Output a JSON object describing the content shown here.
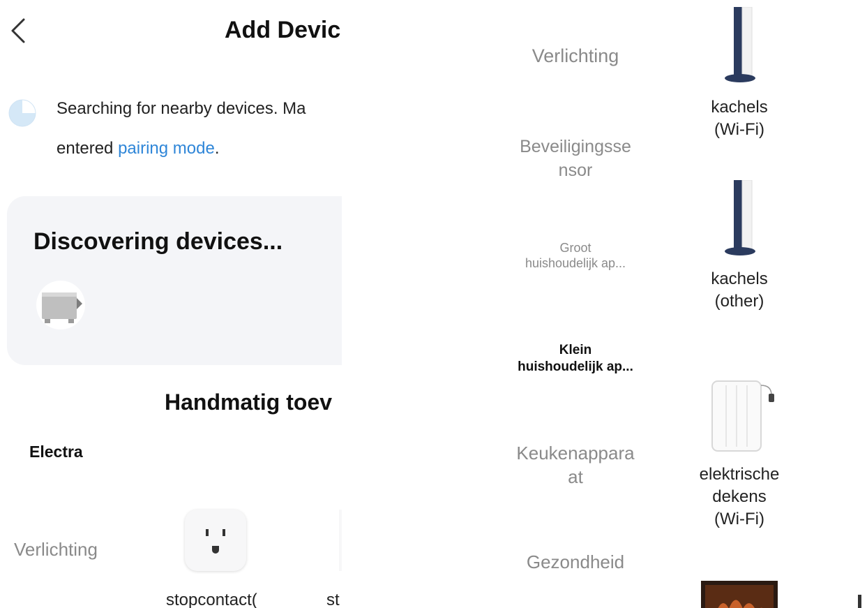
{
  "header": {
    "title": "Add Devic"
  },
  "search": {
    "line1": "Searching for nearby devices. Ma",
    "line2_prefix": "entered ",
    "link": "pairing mode",
    "line2_suffix": "."
  },
  "discover": {
    "title": "Discovering devices..."
  },
  "manual": {
    "title": "Handmatig toev"
  },
  "brand": {
    "label": "Electra"
  },
  "left_categories": [
    "Verlichting"
  ],
  "left_products": [
    {
      "label": "stopcontact(",
      "icon": "outlet-icon"
    },
    {
      "label": "st"
    }
  ],
  "categories": [
    "Verlichting",
    "Beveiligingsse nsor",
    "Groot huishoudelijk ap...",
    "Klein huishoudelijk ap...",
    "Keukenappara at",
    "Gezondheid"
  ],
  "categories_display": {
    "c2a": "Beveiligingsse",
    "c2b": "nsor",
    "c3a": "Groot",
    "c3b": "huishoudelijk ap...",
    "c4a": "Klein",
    "c4b": "huishoudelijk ap...",
    "c5a": "Keukenappara",
    "c5b": "at"
  },
  "selected_category": "Klein huishoudelijk ap...",
  "products": [
    {
      "line1": "kachels",
      "line2": "(Wi-Fi)",
      "icon": "heater-icon"
    },
    {
      "line1": "kachels",
      "line2": "(other)",
      "icon": "heater-icon"
    },
    {
      "line1": "elektrische",
      "line2": "dekens",
      "line3": "(Wi-Fi)",
      "icon": "blanket-icon"
    }
  ],
  "colors": {
    "link": "#2f86d8",
    "card": "#f4f5f8",
    "muted": "#8a8a8a",
    "heater_accent": "#2b3b5e"
  }
}
